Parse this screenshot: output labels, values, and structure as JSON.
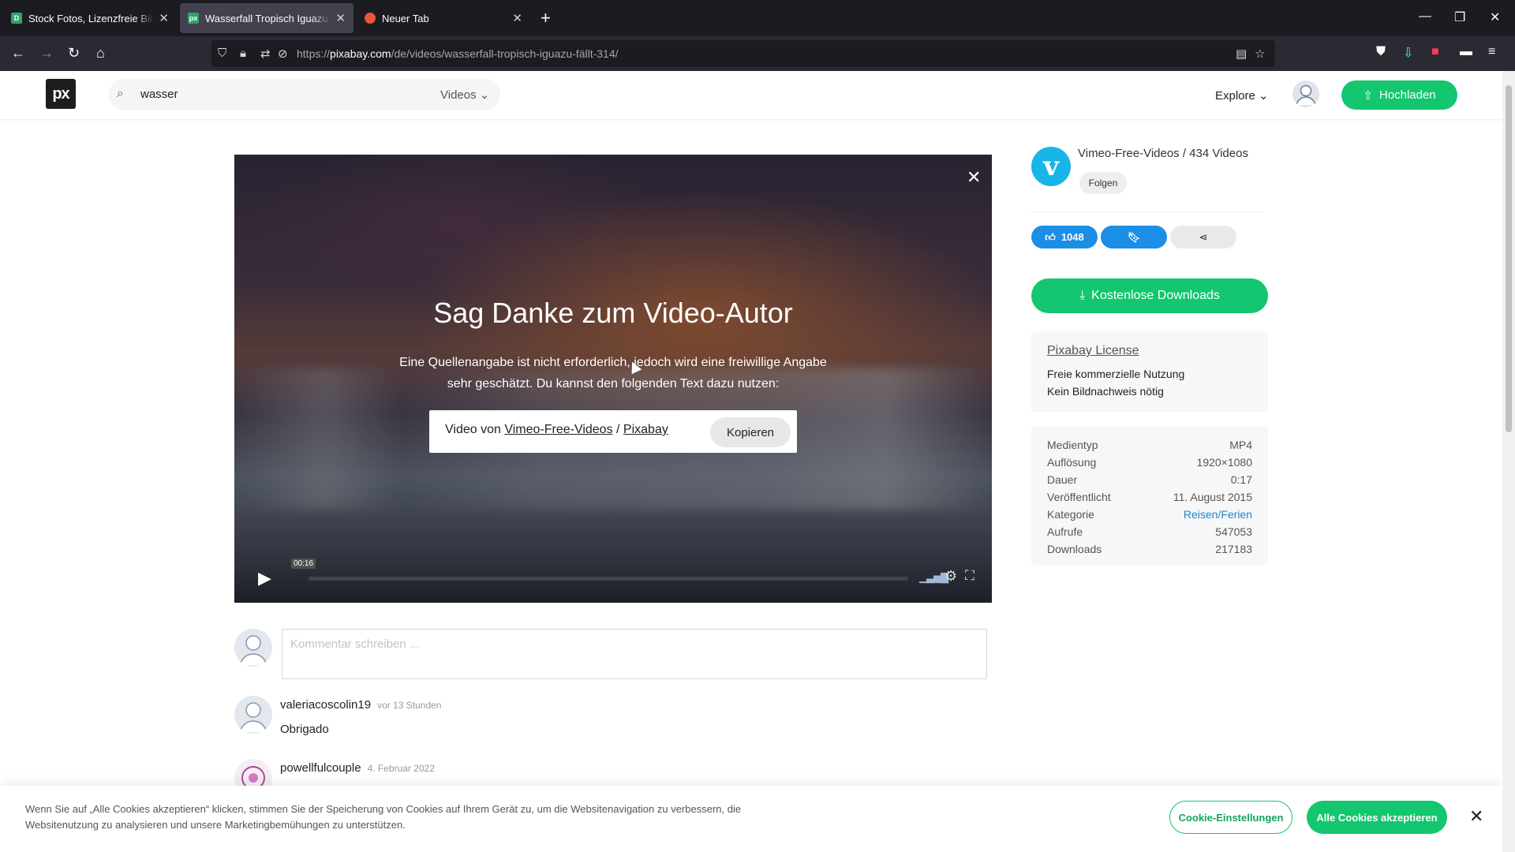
{
  "browser": {
    "tabs": [
      {
        "title": "Stock Fotos, Lizenzfreie Bilder &",
        "favicon_color": "#2ea56b",
        "favicon_text": "D"
      },
      {
        "title": "Wasserfall Tropisch Iguazu Fällt",
        "favicon_color": "#2ea56b",
        "favicon_text": "px"
      },
      {
        "title": "Neuer Tab",
        "favicon_color": "#e8553b",
        "favicon_text": ""
      }
    ],
    "url_prefix": "https://",
    "url_host": "pixabay.com",
    "url_path": "/de/videos/wasserfall-tropisch-iguazu-fällt-314/"
  },
  "header": {
    "logo": "px",
    "search_value": "wasser",
    "search_type": "Videos",
    "explore": "Explore",
    "upload": "Hochladen"
  },
  "video": {
    "heading": "Sag Danke zum Video-Autor",
    "description": "Eine Quellenangabe ist nicht erforderlich, jedoch wird eine freiwillige Angabe sehr geschätzt. Du kannst den folgenden Text dazu nutzen:",
    "credit_prefix": "Video von ",
    "credit_author": "Vimeo-Free-Videos",
    "credit_sep": " / ",
    "credit_site": "Pixabay",
    "copy": "Kopieren",
    "time": "00:16"
  },
  "comments": {
    "placeholder": "Kommentar schreiben ...",
    "items": [
      {
        "user": "valeriacoscolin19",
        "when": "vor 13 Stunden",
        "text": "Obrigado"
      },
      {
        "user": "powellfulcouple",
        "when": "4. Februar 2022",
        "text": ""
      }
    ]
  },
  "sidebar": {
    "author": "Vimeo-Free-Videos / 434 Videos",
    "follow": "Folgen",
    "likes": "1048",
    "download": "Kostenlose Downloads",
    "license_title": "Pixabay License",
    "license_line1": "Freie kommerzielle Nutzung",
    "license_line2": "Kein Bildnachweis nötig",
    "info": [
      {
        "label": "Medientyp",
        "value": "MP4"
      },
      {
        "label": "Auflösung",
        "value": "1920×1080"
      },
      {
        "label": "Dauer",
        "value": "0:17"
      },
      {
        "label": "Veröffentlicht",
        "value": "11. August 2015"
      },
      {
        "label": "Kategorie",
        "value": "Reisen/Ferien"
      },
      {
        "label": "Aufrufe",
        "value": "547053"
      },
      {
        "label": "Downloads",
        "value": "217183"
      }
    ]
  },
  "cookie": {
    "text": "Wenn Sie auf „Alle Cookies akzeptieren“ klicken, stimmen Sie der Speicherung von Cookies auf Ihrem Gerät zu, um die Websitenavigation zu verbessern, die Websitenutzung zu analysieren und unsere Marketingbemühungen zu unterstützen.",
    "settings": "Cookie-Einstellungen",
    "accept": "Alle Cookies akzeptieren"
  },
  "colors": {
    "brand_green": "#13c66f",
    "like_blue": "#1b8ee6",
    "vimeo_blue": "#17b5e8",
    "link_blue": "#1e87c8"
  }
}
